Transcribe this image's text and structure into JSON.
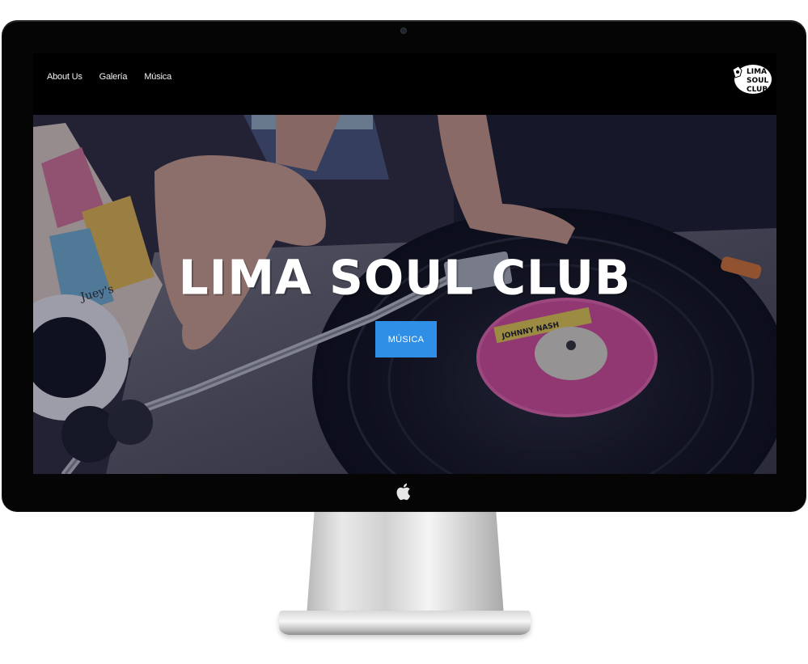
{
  "nav": {
    "links": [
      {
        "label": "About Us"
      },
      {
        "label": "Galería"
      },
      {
        "label": "Música"
      }
    ],
    "logo_text": [
      "LIMA",
      "SOUL",
      "CLUB"
    ]
  },
  "hero": {
    "title": "LIMA SOUL CLUB",
    "cta_label": "MÚSICA",
    "record_label_text": "JOHNNY NASH",
    "sleeve_text": "Juey's"
  },
  "colors": {
    "accent": "#2f8fe6",
    "nav_bg": "#000000",
    "bezel": "#050505",
    "record_label": "#e04f9c"
  },
  "icons": [
    "apple-logo-icon",
    "camera-icon"
  ]
}
